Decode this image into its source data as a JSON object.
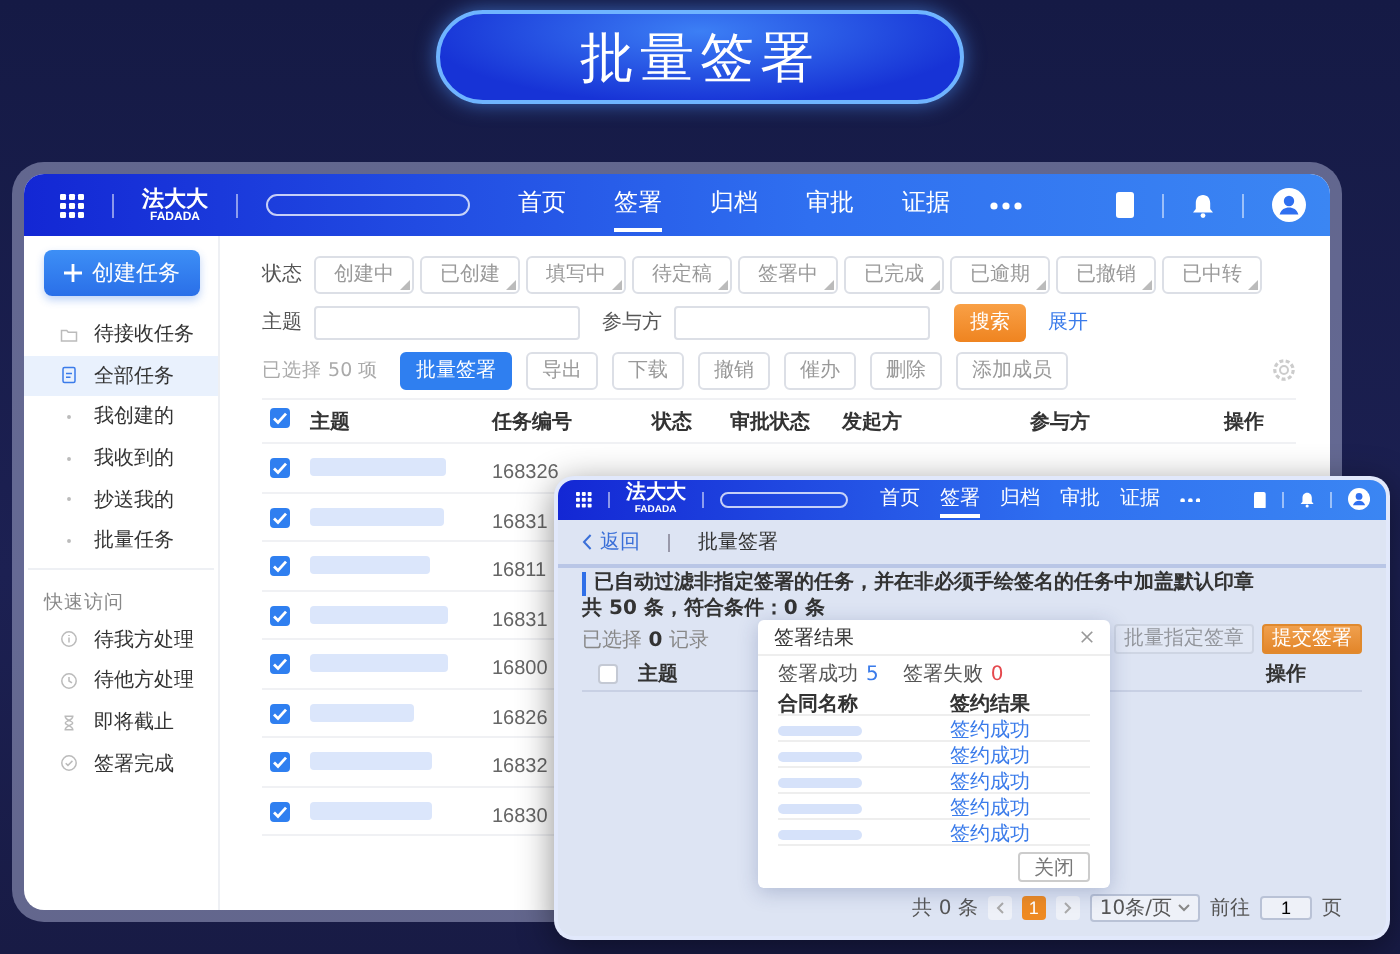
{
  "banner": {
    "title": "批量签署"
  },
  "main_window": {
    "nav": {
      "logo": {
        "name": "法大大",
        "latin": "FADADA"
      },
      "tabs": [
        {
          "label": "首页",
          "selected": false
        },
        {
          "label": "签署",
          "selected": true
        },
        {
          "label": "归档",
          "selected": false
        },
        {
          "label": "审批",
          "selected": false
        },
        {
          "label": "证据",
          "selected": false
        }
      ]
    },
    "sidebar": {
      "create_button": "创建任务",
      "items": [
        {
          "label": "待接收任务",
          "kind": "folder",
          "selected": false
        },
        {
          "label": "全部任务",
          "kind": "document",
          "selected": true
        },
        {
          "label": "我创建的",
          "kind": "sub",
          "selected": false
        },
        {
          "label": "我收到的",
          "kind": "sub",
          "selected": false
        },
        {
          "label": "抄送我的",
          "kind": "sub",
          "selected": false
        },
        {
          "label": "批量任务",
          "kind": "sub",
          "selected": false
        }
      ],
      "section_title": "快速访问",
      "quick_items": [
        {
          "label": "待我方处理",
          "kind": "info",
          "selected": false
        },
        {
          "label": "待他方处理",
          "kind": "clock",
          "selected": false
        },
        {
          "label": "即将截止",
          "kind": "hourglass",
          "selected": false
        },
        {
          "label": "签署完成",
          "kind": "done",
          "selected": false
        }
      ]
    },
    "filters": {
      "status_label": "状态",
      "status_options": [
        {
          "label": "创建中",
          "selected": false
        },
        {
          "label": "已创建",
          "selected": false
        },
        {
          "label": "填写中",
          "selected": false
        },
        {
          "label": "待定稿",
          "selected": false
        },
        {
          "label": "签署中",
          "selected": false
        },
        {
          "label": "已完成",
          "selected": false
        },
        {
          "label": "已逾期",
          "selected": false
        },
        {
          "label": "已撤销",
          "selected": false
        },
        {
          "label": "已中转",
          "selected": false
        }
      ],
      "subject_label": "主题",
      "participant_label": "参与方",
      "search_button": "搜索",
      "expand_link": "展开"
    },
    "toolbar": {
      "selection": "已选择 50 项",
      "buttons": [
        {
          "label": "批量签署",
          "kind": "primary"
        },
        {
          "label": "导出",
          "kind": "default"
        },
        {
          "label": "下载",
          "kind": "default"
        },
        {
          "label": "撤销",
          "kind": "default"
        },
        {
          "label": "催办",
          "kind": "default"
        },
        {
          "label": "删除",
          "kind": "default"
        },
        {
          "label": "添加成员",
          "kind": "default"
        }
      ]
    },
    "table": {
      "columns": [
        "主题",
        "任务编号",
        "状态",
        "审批状态",
        "发起方",
        "参与方",
        "操作"
      ],
      "all_checked": true,
      "rows": [
        {
          "checked": true,
          "task_number": "168326"
        },
        {
          "checked": true,
          "task_number": "16831"
        },
        {
          "checked": true,
          "task_number": "16811"
        },
        {
          "checked": true,
          "task_number": "16831"
        },
        {
          "checked": true,
          "task_number": "16800"
        },
        {
          "checked": true,
          "task_number": "16826"
        },
        {
          "checked": true,
          "task_number": "16832"
        },
        {
          "checked": true,
          "task_number": "16830"
        }
      ]
    }
  },
  "batch_window": {
    "nav": {
      "logo": {
        "name": "法大大",
        "latin": "FADADA"
      },
      "tabs": [
        {
          "label": "首页",
          "selected": false
        },
        {
          "label": "签署",
          "selected": true
        },
        {
          "label": "归档",
          "selected": false
        },
        {
          "label": "审批",
          "selected": false
        },
        {
          "label": "证据",
          "selected": false
        }
      ]
    },
    "back_link": "返回",
    "page_title": "批量签署",
    "notice": "已自动过滤非指定签署的任务，并在非必须手绘签名的任务中加盖默认印章",
    "summary": "共 50 条，符合条件：0 条",
    "selection": "已选择 **0** 记录",
    "buttons": [
      {
        "label": "批量指定签章",
        "kind": "default",
        "disabled": true
      },
      {
        "label": "提交签署",
        "kind": "primary",
        "disabled": false
      }
    ],
    "table": {
      "columns": [
        "主题",
        "操作"
      ],
      "all_checked": false
    },
    "dialog": {
      "title": "签署结果",
      "stats": [
        {
          "label": "签署成功",
          "count": "5",
          "color": "#3a7bea"
        },
        {
          "label": "签署失败",
          "count": "0",
          "color": "#e5484d"
        }
      ],
      "columns": [
        "合同名称",
        "签约结果"
      ],
      "rows": [
        {
          "result": "签约成功"
        },
        {
          "result": "签约成功"
        },
        {
          "result": "签约成功"
        },
        {
          "result": "签约成功"
        },
        {
          "result": "签约成功"
        }
      ],
      "close_button": "关闭"
    },
    "pagination": {
      "total": "共 0 条",
      "pages": [
        {
          "label": "1",
          "selected": true
        }
      ],
      "page_size": "10条/页",
      "goto_label": "前往",
      "goto_value": "1",
      "page_suffix": "页"
    }
  }
}
